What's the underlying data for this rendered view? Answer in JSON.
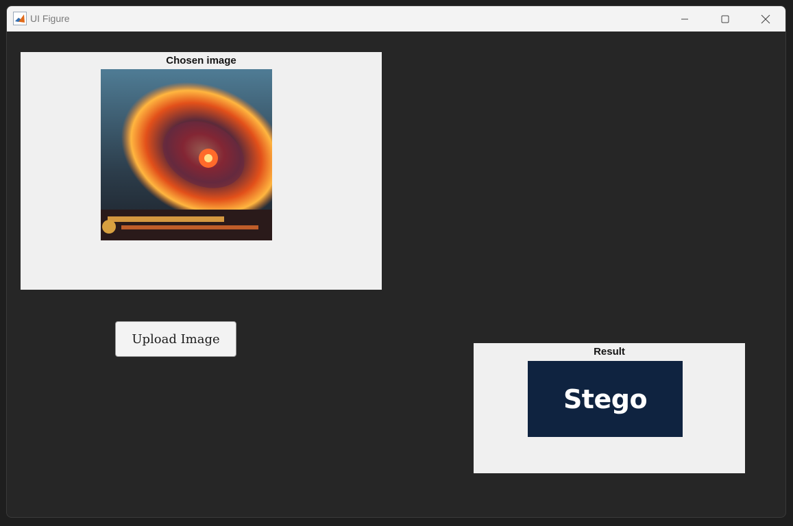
{
  "window": {
    "title": "UI Figure"
  },
  "chosen_panel": {
    "title": "Chosen image"
  },
  "upload_button": {
    "label": "Upload Image"
  },
  "result_panel": {
    "title": "Result",
    "image_text": "Stego"
  },
  "colors": {
    "panel_bg": "#f0f0f0",
    "figure_bg": "#262626",
    "result_bg": "#0f2340"
  }
}
